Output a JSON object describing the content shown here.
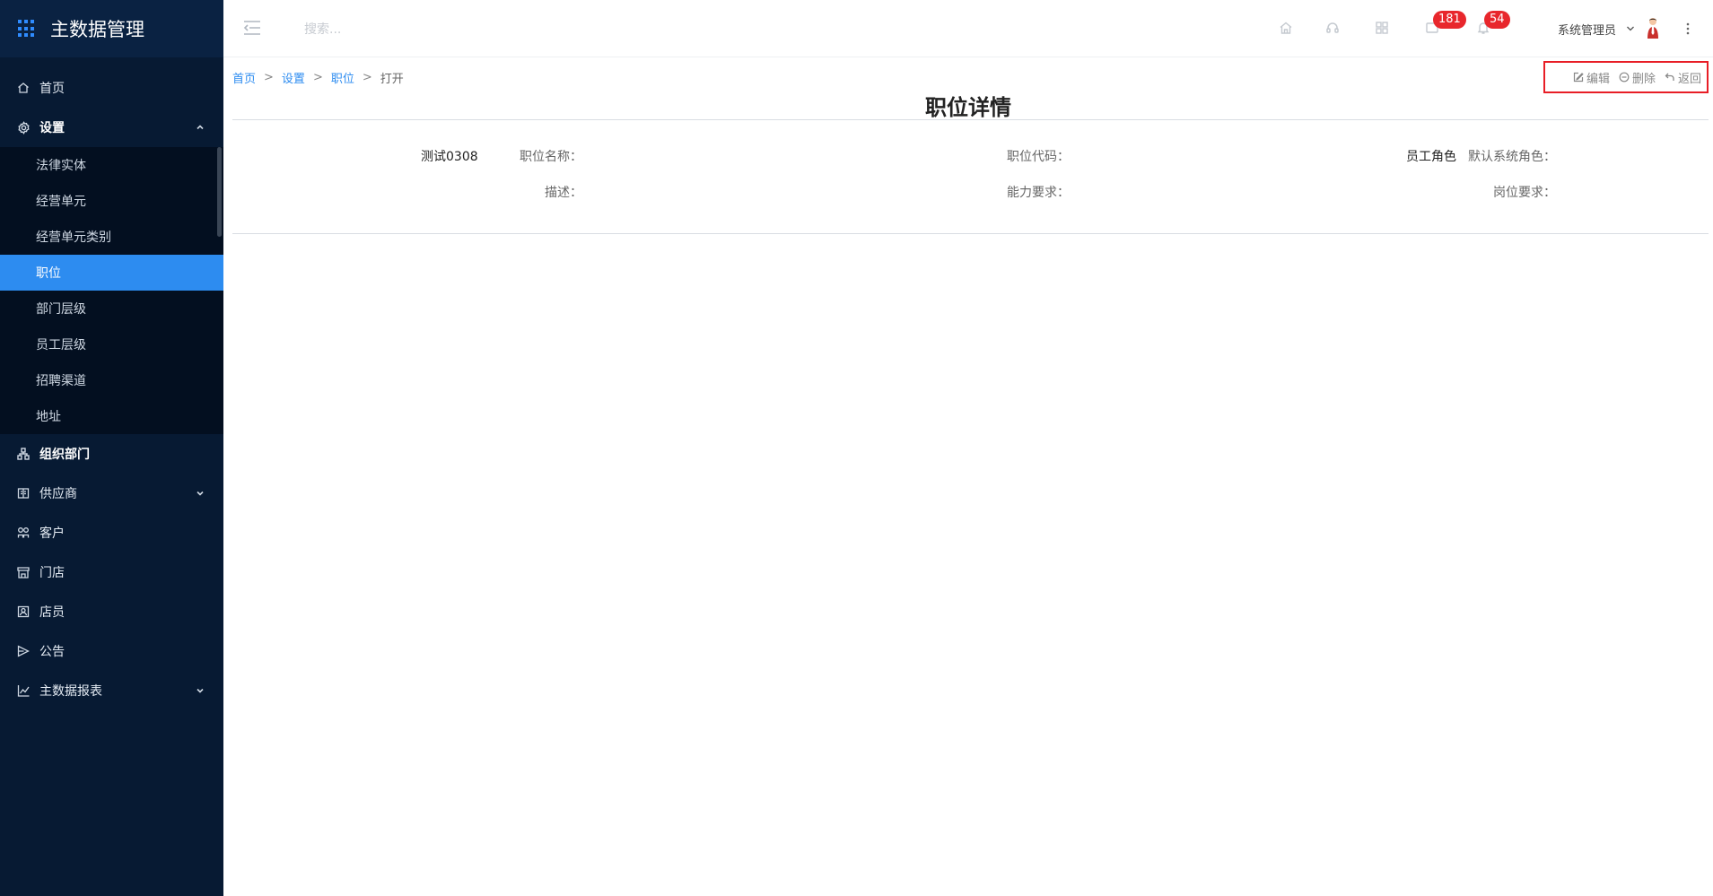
{
  "app": {
    "title": "主数据管理"
  },
  "sidebar": {
    "items": [
      {
        "label": "首页",
        "icon": "home-icon"
      },
      {
        "label": "设置",
        "icon": "gear-icon",
        "expanded": true,
        "children": [
          "法律实体",
          "经营单元",
          "经营单元类别",
          "职位",
          "部门层级",
          "员工层级",
          "招聘渠道",
          "地址"
        ],
        "active_child": "职位"
      },
      {
        "label": "组织部门",
        "icon": "org-chart-icon"
      },
      {
        "label": "供应商",
        "icon": "supplier-icon",
        "has_children": true
      },
      {
        "label": "客户",
        "icon": "customer-icon"
      },
      {
        "label": "门店",
        "icon": "store-icon"
      },
      {
        "label": "店员",
        "icon": "clerk-icon"
      },
      {
        "label": "公告",
        "icon": "announcement-icon"
      },
      {
        "label": "主数据报表",
        "icon": "report-chart-icon",
        "has_children": true
      }
    ]
  },
  "header": {
    "search_placeholder": "搜索...",
    "messages_badge": "181",
    "notifications_badge": "54",
    "user_name": "系统管理员"
  },
  "breadcrumb": {
    "items": [
      "首页",
      "设置",
      "职位"
    ],
    "separator": ">",
    "current": "打开"
  },
  "actions": {
    "edit": "编辑",
    "delete": "删除",
    "back": "返回"
  },
  "page": {
    "title": "职位详情",
    "fields": {
      "position_name": {
        "label": "职位名称：",
        "value": "测试0308"
      },
      "position_code": {
        "label": "职位代码：",
        "value": ""
      },
      "default_role": {
        "label": "默认系统角色：",
        "value": "员工角色"
      },
      "description": {
        "label": "描述：",
        "value": ""
      },
      "ability": {
        "label": "能力要求：",
        "value": ""
      },
      "post_requirement": {
        "label": "岗位要求：",
        "value": ""
      }
    }
  },
  "colors": {
    "sidebar_bg": "#071a33",
    "submenu_bg": "#030f20",
    "accent": "#2d8cf0",
    "badge": "#e8272c",
    "highlight_box": "#e81e26"
  }
}
